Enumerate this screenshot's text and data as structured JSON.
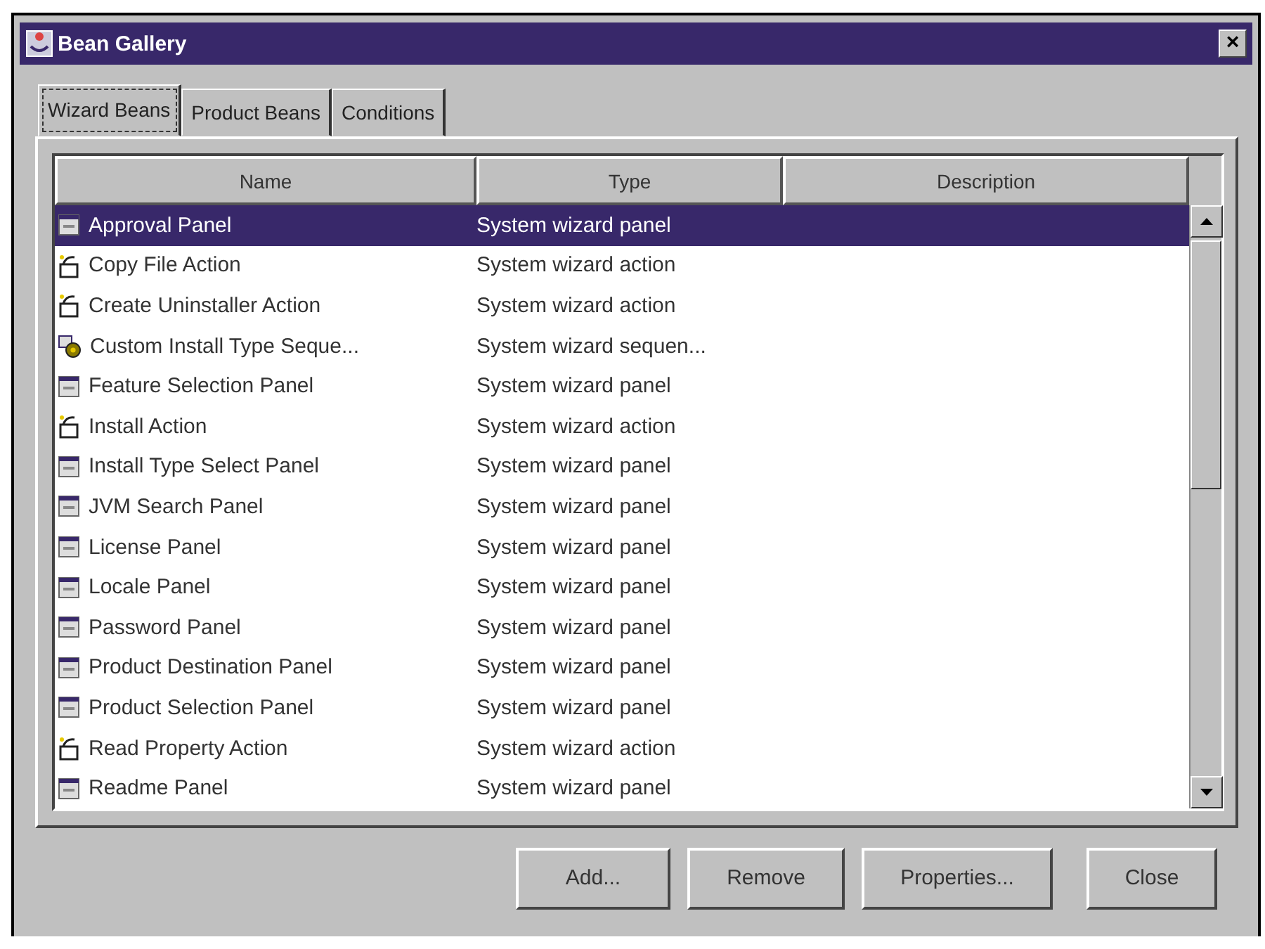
{
  "window": {
    "title": "Bean Gallery",
    "close": "×"
  },
  "tabs": [
    {
      "label": "Wizard Beans",
      "selected": true
    },
    {
      "label": "Product Beans",
      "selected": false
    },
    {
      "label": "Conditions",
      "selected": false
    }
  ],
  "table": {
    "columns": [
      "Name",
      "Type",
      "Description"
    ],
    "rows": [
      {
        "kind": "panel",
        "name": "Approval Panel",
        "type": "System wizard panel",
        "selected": true
      },
      {
        "kind": "action",
        "name": "Copy File Action",
        "type": "System wizard action",
        "selected": false
      },
      {
        "kind": "action",
        "name": "Create Uninstaller Action",
        "type": "System wizard action",
        "selected": false
      },
      {
        "kind": "sequence",
        "name": "Custom Install Type Seque...",
        "type": "System wizard sequen...",
        "selected": false
      },
      {
        "kind": "panel",
        "name": "Feature Selection Panel",
        "type": "System wizard panel",
        "selected": false
      },
      {
        "kind": "action",
        "name": "Install Action",
        "type": "System wizard action",
        "selected": false
      },
      {
        "kind": "panel",
        "name": "Install Type Select Panel",
        "type": "System wizard panel",
        "selected": false
      },
      {
        "kind": "panel",
        "name": "JVM Search Panel",
        "type": "System wizard panel",
        "selected": false
      },
      {
        "kind": "panel",
        "name": "License Panel",
        "type": "System wizard panel",
        "selected": false
      },
      {
        "kind": "panel",
        "name": "Locale Panel",
        "type": "System wizard panel",
        "selected": false
      },
      {
        "kind": "panel",
        "name": "Password Panel",
        "type": "System wizard panel",
        "selected": false
      },
      {
        "kind": "panel",
        "name": "Product Destination Panel",
        "type": "System wizard panel",
        "selected": false
      },
      {
        "kind": "panel",
        "name": "Product Selection Panel",
        "type": "System wizard panel",
        "selected": false
      },
      {
        "kind": "action",
        "name": "Read Property Action",
        "type": "System wizard action",
        "selected": false
      },
      {
        "kind": "panel",
        "name": "Readme Panel",
        "type": "System wizard panel",
        "selected": false
      }
    ]
  },
  "buttons": [
    "Add...",
    "Remove",
    "Properties...",
    "Close"
  ]
}
